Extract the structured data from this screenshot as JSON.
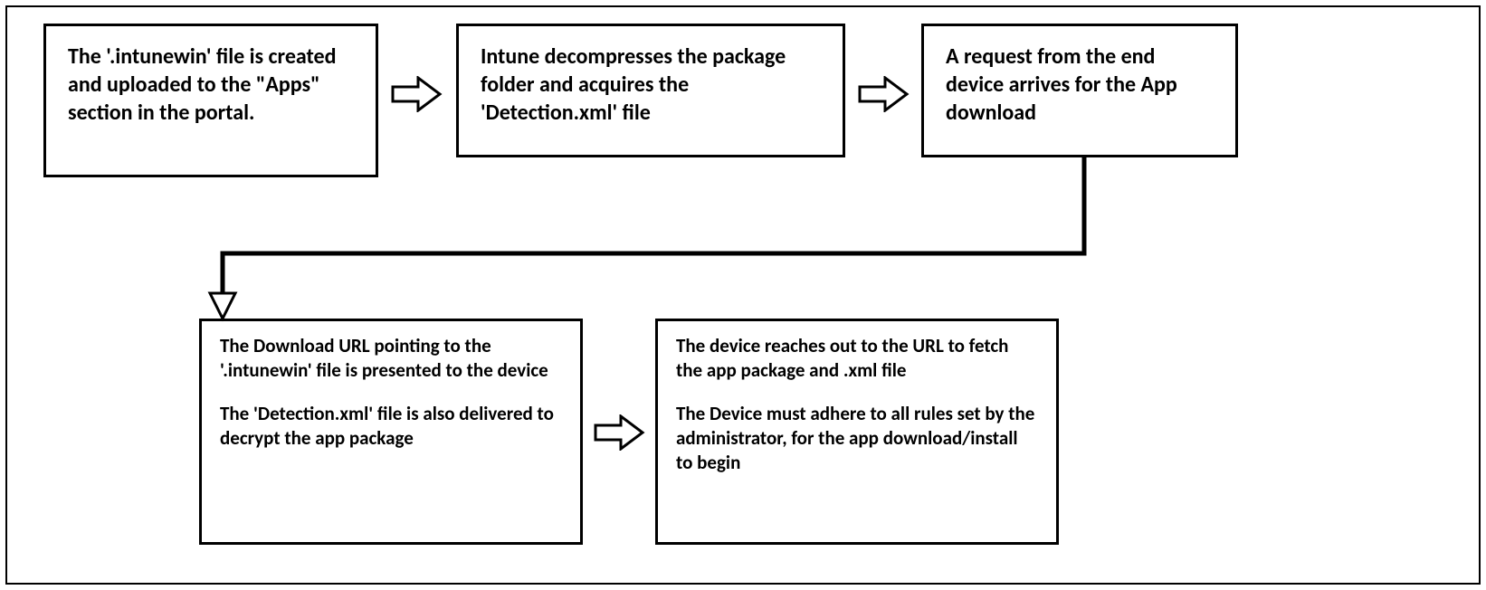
{
  "boxes": {
    "b1": "The '.intunewin' file is created and uploaded to the \"Apps\" section in the portal.",
    "b2": "Intune decompresses the package folder and acquires the 'Detection.xml' file",
    "b3": "A request from the end device arrives for the App download",
    "b4a": "The Download URL pointing to the '.intunewin' file is presented to the device",
    "b4b": "The 'Detection.xml' file is also delivered to decrypt the app package",
    "b5a": "The device reaches out to the URL to fetch the app package and .xml file",
    "b5b": "The Device must adhere to all rules set by the administrator, for the app download/install to begin"
  }
}
